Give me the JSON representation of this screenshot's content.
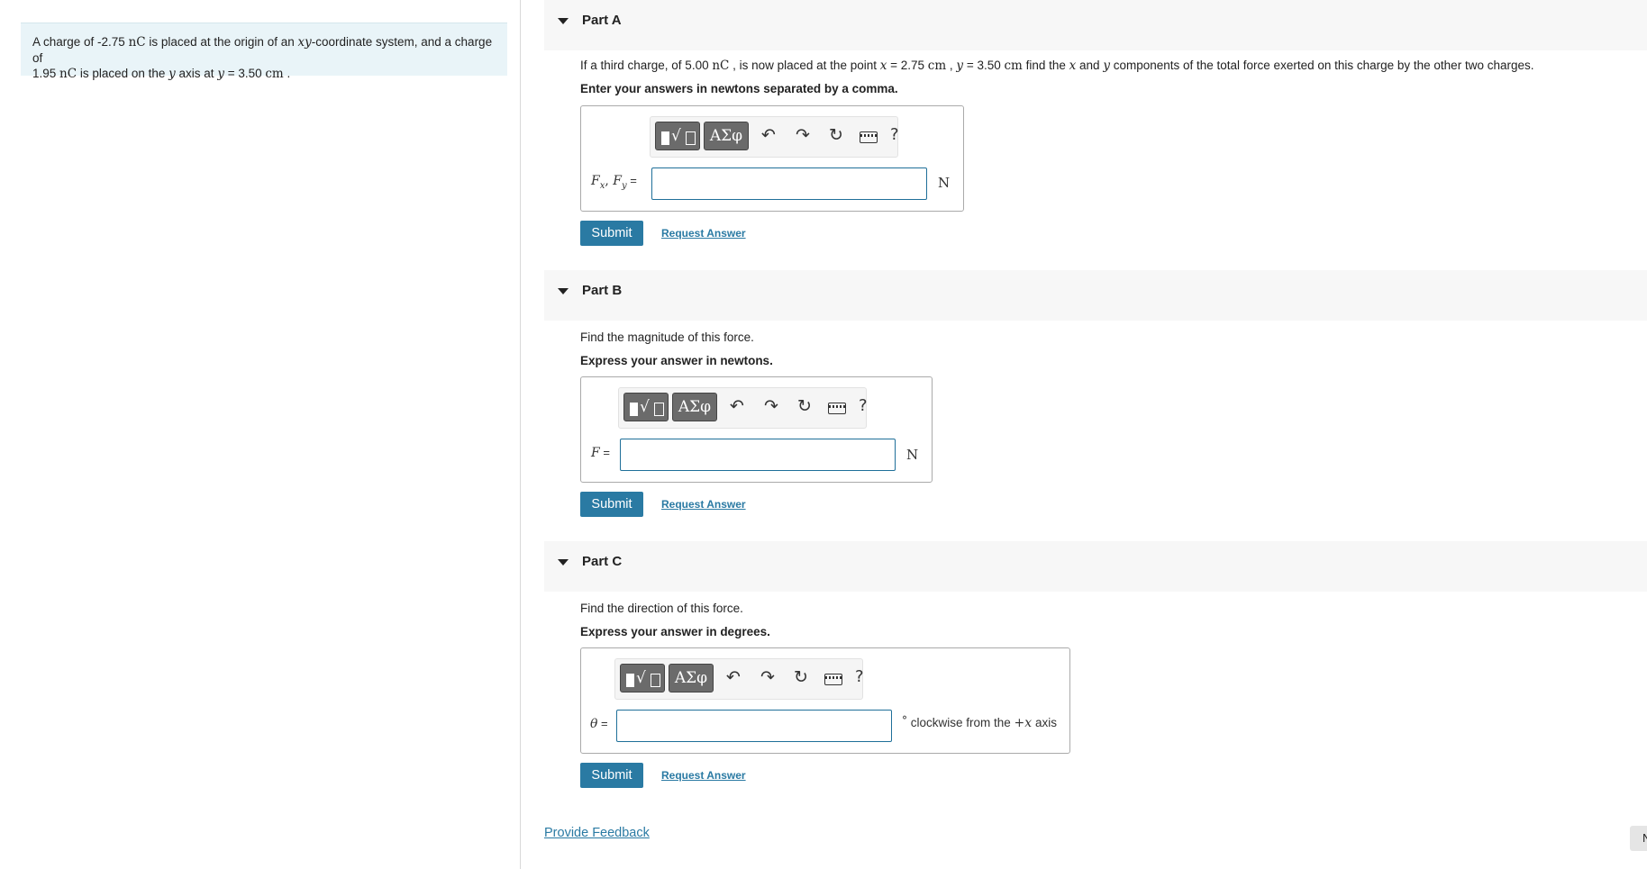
{
  "problem": {
    "t1": "A charge of -2.75 ",
    "u1": "nC",
    "t2": " is placed at the origin of an ",
    "v1": "xy",
    "t3": "-coordinate system, and a charge of",
    "t4": "1.95 ",
    "u2": "nC",
    "t5": " is placed on the ",
    "v2": "y",
    "t6": " axis at ",
    "v3": "y",
    "t7": " = 3.50 ",
    "u3": "cm",
    "t8": " ."
  },
  "toolbar": {
    "template_icon": "fraction-radical-template-icon",
    "greek_label": "ΑΣφ",
    "undo_glyph": "↶",
    "redo_glyph": "↷",
    "reset_glyph": "↻",
    "keyboard_icon": "keyboard-icon",
    "help_glyph": "?"
  },
  "parts": [
    {
      "title": "Part A",
      "q": {
        "t1": "If a third charge, of 5.00 ",
        "u1": "nC",
        "t2": " , is now placed at the point ",
        "v1": "x",
        "t3": " = 2.75 ",
        "u2": "cm",
        "t4": " , ",
        "v2": "y",
        "t5": " = 3.50 ",
        "u3": "cm",
        "t6": " find the ",
        "v3": "x",
        "t7": " and ",
        "v4": "y",
        "t8": " components of the total force exerted on this charge by the other two charges."
      },
      "instruction": "Enter your answers in newtons separated by a comma.",
      "var1": "F",
      "sub1": "x",
      "sep": ", ",
      "var2": "F",
      "sub2": "y",
      "eq": " =",
      "input_value": "",
      "unit": "N",
      "submit": "Submit",
      "request": "Request Answer"
    },
    {
      "title": "Part B",
      "q": "Find the magnitude of this force.",
      "instruction": "Express your answer in newtons.",
      "var": "F",
      "eq": " =",
      "input_value": "",
      "unit": "N",
      "submit": "Submit",
      "request": "Request Answer"
    },
    {
      "title": "Part C",
      "q": "Find the direction of this force.",
      "instruction": "Express your answer in degrees.",
      "var": "θ",
      "eq": " =",
      "input_value": "",
      "unit_deg": "°",
      "unit_t1": " clockwise from the ",
      "unit_v": "+x",
      "unit_t2": " axis",
      "submit": "Submit",
      "request": "Request Answer"
    }
  ],
  "feedback": "Provide Feedback",
  "corner_tab": "N",
  "colors": {
    "accent": "#2a7aa3",
    "problem_bg": "#e9f4f8",
    "part_header_bg": "#f7f7f7",
    "toolbar_button": "#6b6b6b"
  }
}
